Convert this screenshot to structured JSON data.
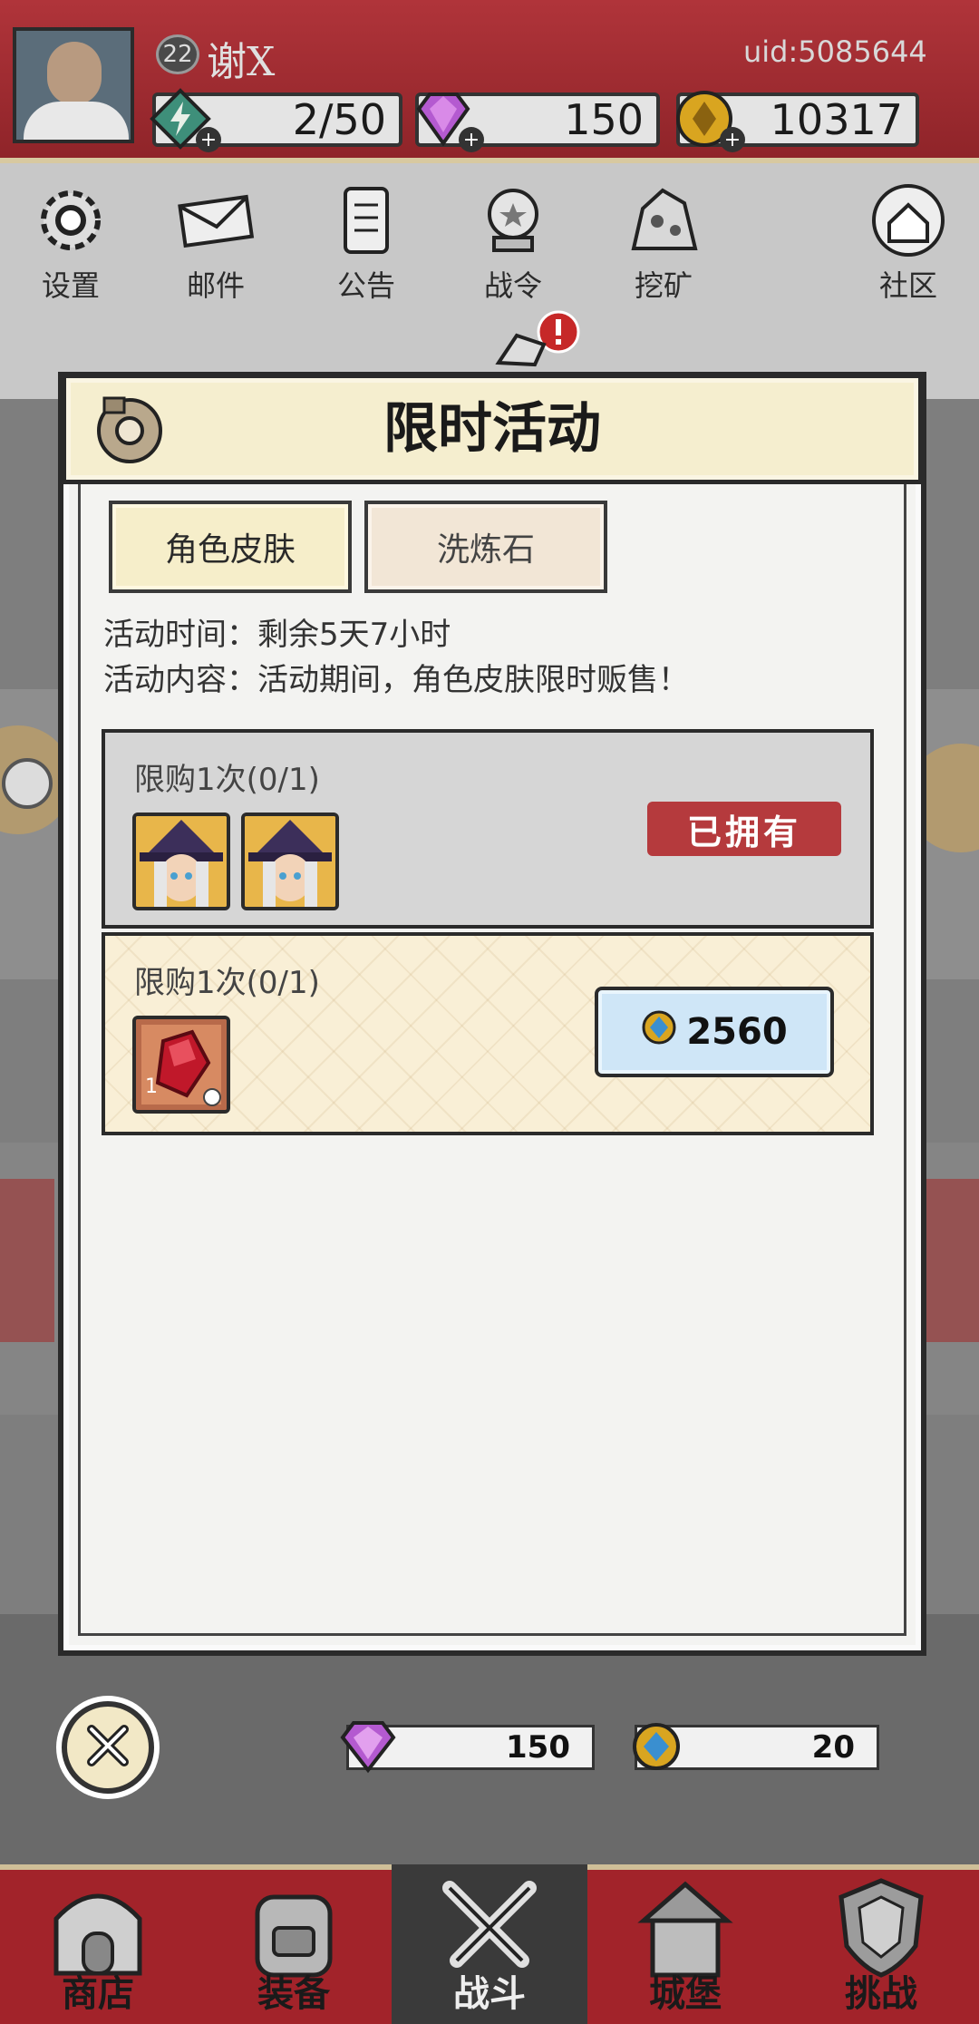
{
  "player": {
    "level": "22",
    "name": "谢X",
    "uid": "uid:5085644"
  },
  "resources": {
    "stamina": "2/50",
    "gems": "150",
    "gold": "10317"
  },
  "menu": {
    "items": [
      {
        "label": "设置",
        "icon": "gear-icon"
      },
      {
        "label": "邮件",
        "icon": "mail-icon"
      },
      {
        "label": "公告",
        "icon": "scroll-icon"
      },
      {
        "label": "战令",
        "icon": "crystal-ball-icon"
      },
      {
        "label": "挖矿",
        "icon": "ore-icon"
      },
      {
        "label": "社区",
        "icon": "home-icon"
      }
    ]
  },
  "modal": {
    "title": "限时活动",
    "tabs": [
      "角色皮肤",
      "洗炼石"
    ],
    "time_line": "活动时间：剩余5天7小时",
    "content_line": "活动内容：活动期间，角色皮肤限时贩售！",
    "offers": [
      {
        "limit": "限购1次(0/1)",
        "status": "已拥有"
      },
      {
        "limit": "限购1次(0/1)",
        "item_count": "1",
        "price": "2560"
      }
    ]
  },
  "bottom_currency": {
    "gems": "150",
    "tokens": "20"
  },
  "nav": {
    "items": [
      "商店",
      "装备",
      "战斗",
      "城堡",
      "挑战"
    ]
  },
  "colors": {
    "header_red": "#a2232a",
    "owned_red": "#b53a3d",
    "price_blue": "#cfe6f7",
    "title_cream": "#f5eecf"
  }
}
